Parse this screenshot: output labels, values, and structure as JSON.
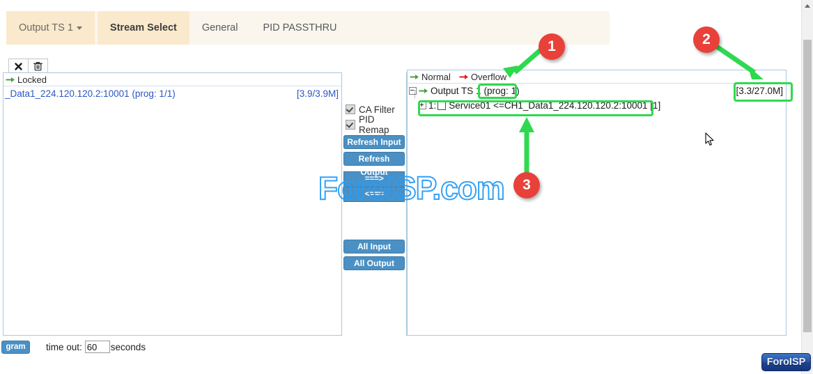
{
  "window": {
    "title": "Stream Select"
  },
  "tabs": [
    {
      "label": "Output TS 1",
      "type": "dropdown",
      "active": false
    },
    {
      "label": "Stream Select",
      "type": "tab",
      "active": true
    },
    {
      "label": "General",
      "type": "tab",
      "active": false
    },
    {
      "label": "PID PASSTHRU",
      "type": "tab",
      "active": false
    }
  ],
  "mini_toolbar": {
    "close_icon": "x-icon",
    "delete_icon": "trash-icon"
  },
  "left_panel": {
    "header_label": "Locked",
    "header_arrow": "green-arrow-icon",
    "streams": [
      {
        "label": "_Data1_224.120.120.2:10001 (prog: 1/1)",
        "bitrate": "[3.9/3.9M]"
      }
    ]
  },
  "middle_column": {
    "checkboxes": [
      {
        "label": "CA Filter",
        "checked": true
      },
      {
        "label": "PID Remap",
        "checked": true
      }
    ],
    "buttons": [
      {
        "label": "Refresh Input",
        "name": "refresh-input-button"
      },
      {
        "label": "Refresh Output",
        "name": "refresh-output-button"
      }
    ],
    "arrow_buttons": [
      {
        "label": "===>",
        "name": "move-right-button"
      },
      {
        "label": "<===",
        "name": "move-left-button"
      }
    ],
    "all_buttons": [
      {
        "label": "All Input",
        "name": "all-input-button"
      },
      {
        "label": "All Output",
        "name": "all-output-button"
      }
    ]
  },
  "right_panel": {
    "legend": {
      "normal_label": "Normal",
      "normal_arrow_color": "#4aa03f",
      "overflow_label": "Overflow",
      "overflow_arrow_color": "#e01b1b"
    },
    "output_node": {
      "label": "Output TS 1",
      "prog": "(prog: 1)",
      "bitrate": "[3.3/27.0M]"
    },
    "services": [
      {
        "index": "1:",
        "label": "Service01 <=CH1_Data1_224.120.120.2:10001 [1]"
      }
    ]
  },
  "bottom_bar": {
    "left_button_label": "gram",
    "timeout_label": "time out:",
    "timeout_value": "60",
    "timeout_unit": "seconds"
  },
  "watermark": {
    "text": "ForoISP.com",
    "color": "#2a9df4"
  },
  "badge": {
    "label": "ForoISP"
  },
  "annotations": {
    "highlight_color": "#2fd94f",
    "circle_color": "#e8413a",
    "markers": [
      {
        "number": "1",
        "target": "output-ts-prog-label"
      },
      {
        "number": "2",
        "target": "output-ts-bitrate"
      },
      {
        "number": "3",
        "target": "service-row-1"
      }
    ]
  }
}
